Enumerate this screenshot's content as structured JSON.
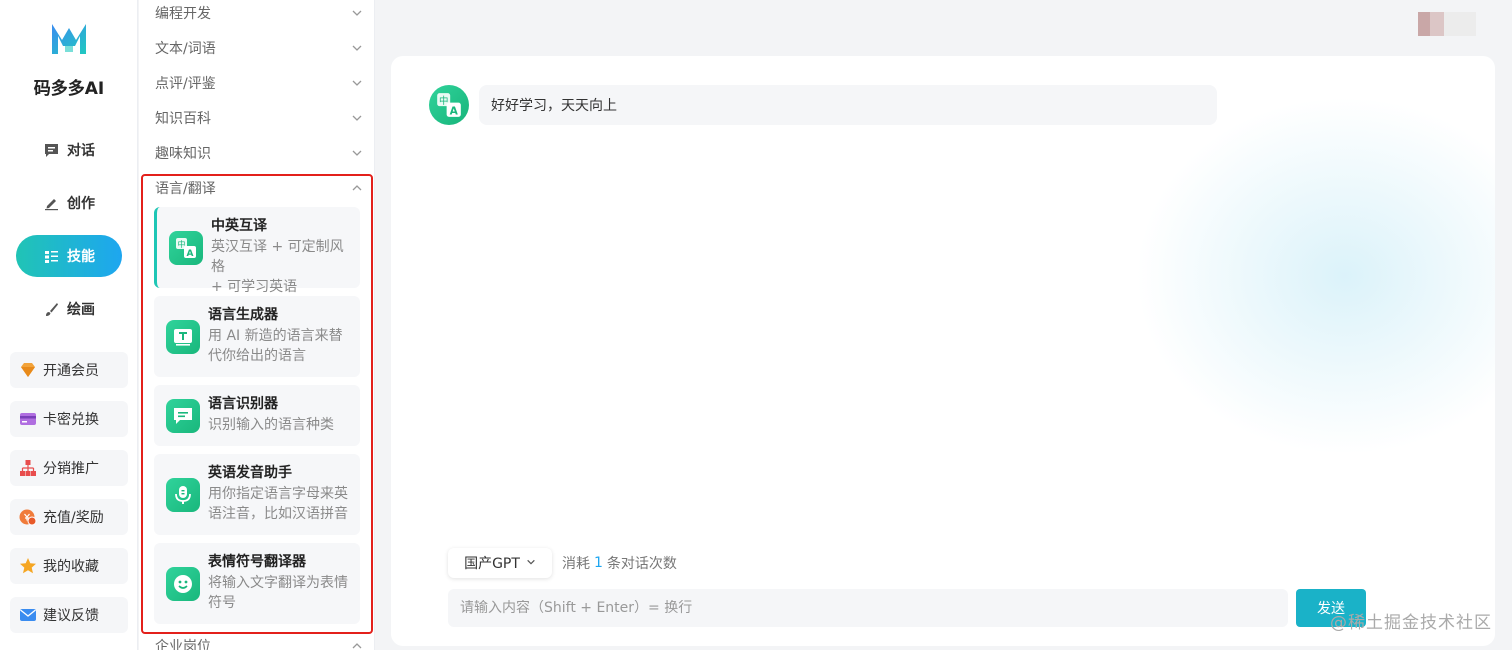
{
  "app": {
    "name": "码多多AI"
  },
  "nav": {
    "items": [
      {
        "label": "对话",
        "icon": "chat-icon",
        "active": false
      },
      {
        "label": "创作",
        "icon": "pen-icon",
        "active": false
      },
      {
        "label": "技能",
        "icon": "list-icon",
        "active": true
      },
      {
        "label": "绘画",
        "icon": "brush-icon",
        "active": false
      }
    ],
    "side_buttons": [
      {
        "label": "开通会员",
        "icon": "diamond-icon"
      },
      {
        "label": "卡密兑换",
        "icon": "card-icon"
      },
      {
        "label": "分销推广",
        "icon": "hierarchy-icon"
      },
      {
        "label": "充值/奖励",
        "icon": "coin-icon"
      },
      {
        "label": "我的收藏",
        "icon": "star-icon"
      },
      {
        "label": "建议反馈",
        "icon": "mail-icon"
      }
    ]
  },
  "skills": {
    "categories_top": [
      {
        "label": "编程开发"
      },
      {
        "label": "文本/词语"
      },
      {
        "label": "点评/评鉴"
      },
      {
        "label": "知识百科"
      },
      {
        "label": "趣味知识"
      }
    ],
    "expanded_category": {
      "label": "语言/翻译"
    },
    "cards": [
      {
        "title": "中英互译",
        "desc": [
          "英汉互译 + 可定制风格",
          "+ 可学习英语"
        ],
        "icon": "translate-icon",
        "selected": true
      },
      {
        "title": "语言生成器",
        "desc": [
          "用 AI 新造的语言来替",
          "代你给出的语言"
        ],
        "icon": "text-icon",
        "selected": false
      },
      {
        "title": "语言识别器",
        "desc": [
          "识别输入的语言种类"
        ],
        "icon": "message-icon",
        "selected": false
      },
      {
        "title": "英语发音助手",
        "desc": [
          "用你指定语言字母来英",
          "语注音，比如汉语拼音"
        ],
        "icon": "microphone-icon",
        "selected": false
      },
      {
        "title": "表情符号翻译器",
        "desc": [
          "将输入文字翻译为表情",
          "符号"
        ],
        "icon": "smiley-icon",
        "selected": false
      }
    ],
    "bottom_category": {
      "label": "企业岗位"
    }
  },
  "chat": {
    "messages": [
      {
        "text": "好好学习，天天向上"
      }
    ],
    "model": "国产GPT",
    "usage": {
      "prefix": "消耗",
      "count": "1",
      "suffix": "条对话次数"
    },
    "input_placeholder": "请输入内容（Shift + Enter）= 换行",
    "send_label": "发送"
  },
  "watermark": "@稀土掘金技术社区",
  "colors": {
    "accent": "#1ab2c8",
    "highlight_border": "#e3201b",
    "icon_green": "#2bcd90"
  }
}
